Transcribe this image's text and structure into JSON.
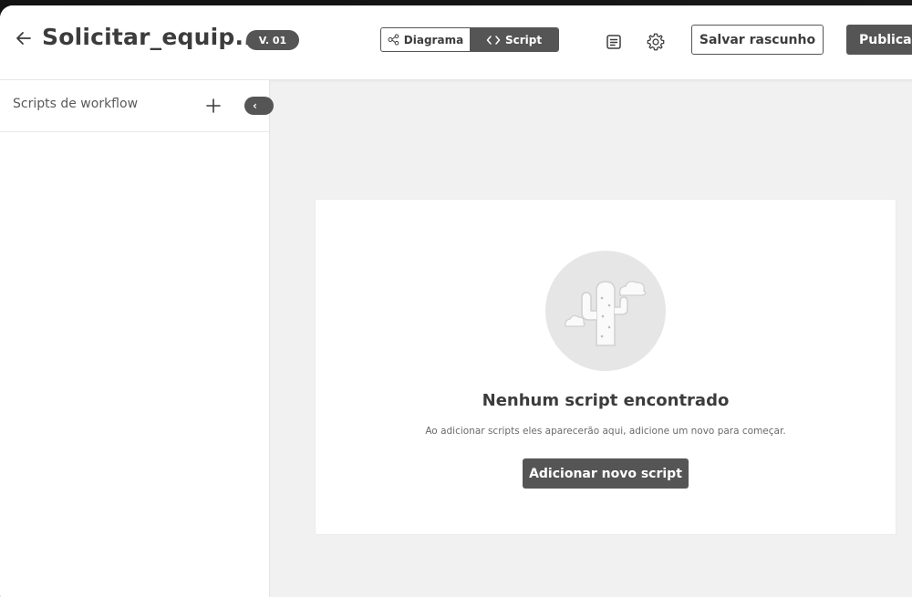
{
  "header": {
    "title": "Solicitar_equip...",
    "version": "V. 01",
    "view_toggle": {
      "diagram_label": "Diagrama",
      "script_label": "Script",
      "active": "Script"
    },
    "save_draft_label": "Salvar rascunho",
    "publish_label": "Publicar"
  },
  "sidebar": {
    "title": "Scripts de workflow",
    "collapse_glyph": "‹"
  },
  "empty_state": {
    "title": "Nenhum script encontrado",
    "subtitle": "Ao adicionar scripts eles aparecerão aqui, adicione um novo para começar.",
    "button_label": "Adicionar novo script",
    "illustration": "cactus-icon"
  },
  "colors": {
    "accent": "#555555",
    "background": "#f1f1f1",
    "surface": "#ffffff",
    "text": "#3c3c3c"
  }
}
